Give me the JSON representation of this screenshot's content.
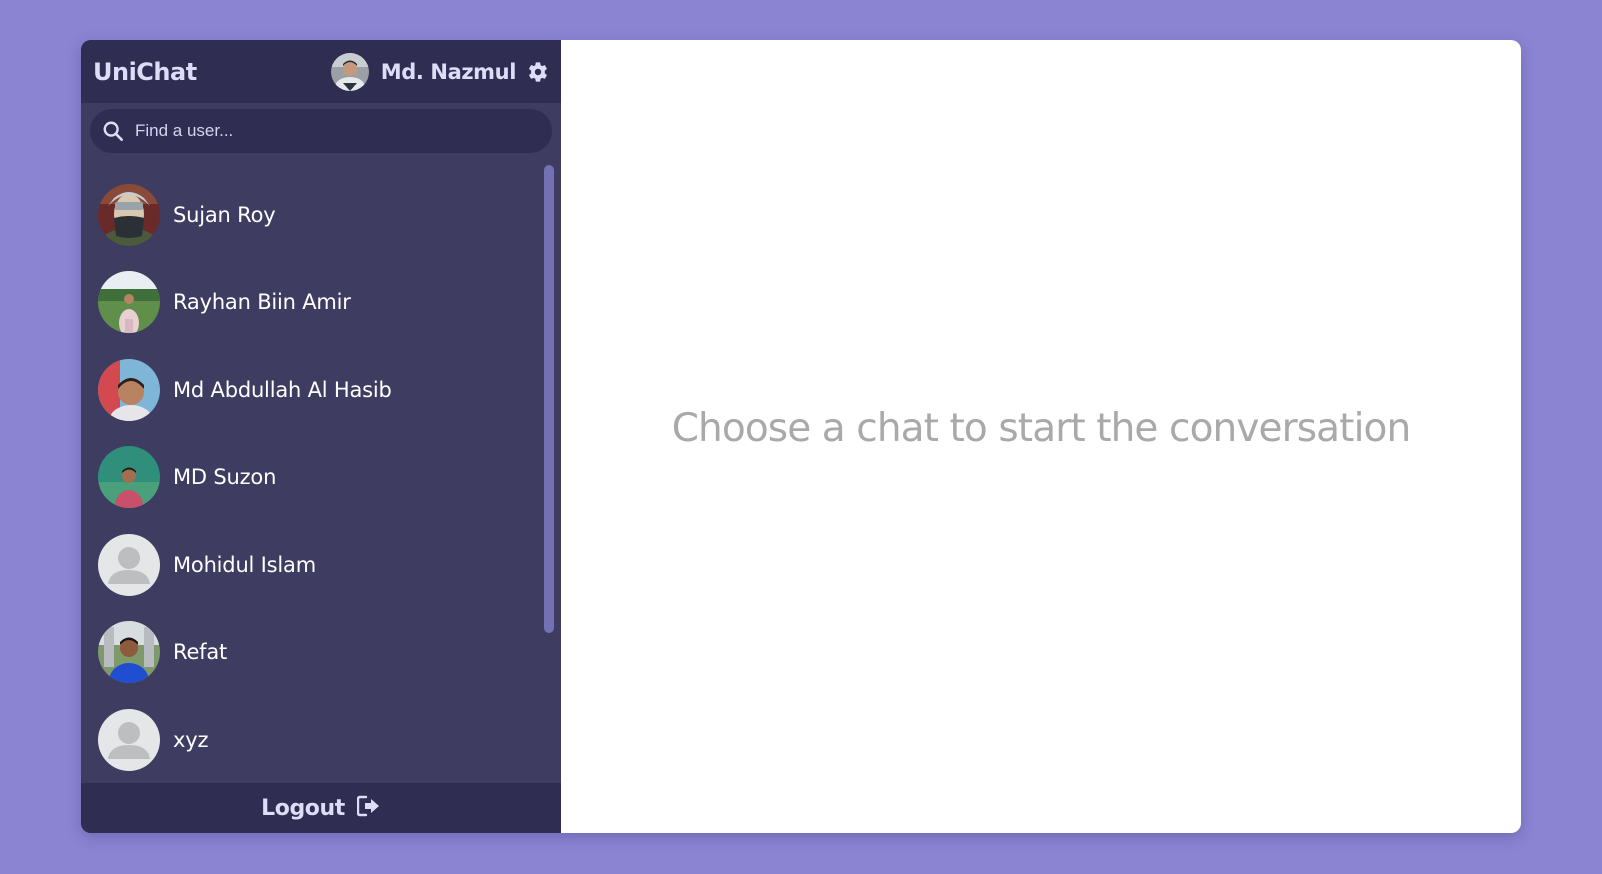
{
  "header": {
    "brand": "UniChat",
    "current_user": {
      "name": "Md. Nazmul",
      "avatar_icon": "user-photo"
    },
    "settings_icon": "gear-icon"
  },
  "search": {
    "placeholder": "Find a user...",
    "value": "",
    "icon": "search-icon"
  },
  "users": [
    {
      "name": "Sujan Roy",
      "avatar": "photo"
    },
    {
      "name": "Rayhan Biin Amir",
      "avatar": "photo"
    },
    {
      "name": "Md Abdullah Al Hasib",
      "avatar": "photo"
    },
    {
      "name": "MD Suzon",
      "avatar": "photo"
    },
    {
      "name": "Mohidul Islam",
      "avatar": "default-user-icon"
    },
    {
      "name": "Refat",
      "avatar": "photo"
    },
    {
      "name": "xyz",
      "avatar": "default-user-icon"
    }
  ],
  "footer": {
    "logout_label": "Logout",
    "logout_icon": "sign-out-icon"
  },
  "main": {
    "placeholder": "Choose a chat to start the conversation"
  },
  "colors": {
    "background": "#8a84d3",
    "sidebar": "#3e3c61",
    "sidebar_dark": "#2f2d52",
    "scrollbar": "#7371b3",
    "placeholder_text": "#a9a9a9"
  }
}
